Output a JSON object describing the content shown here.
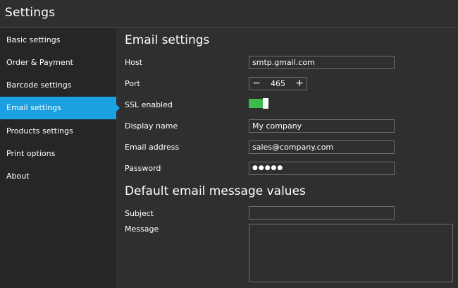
{
  "window": {
    "title": "Settings"
  },
  "sidebar": {
    "items": [
      {
        "label": "Basic settings"
      },
      {
        "label": "Order & Payment"
      },
      {
        "label": "Barcode settings"
      },
      {
        "label": "Email settings",
        "active": true
      },
      {
        "label": "Products settings"
      },
      {
        "label": "Print options"
      },
      {
        "label": "About"
      }
    ]
  },
  "email": {
    "heading": "Email settings",
    "host_label": "Host",
    "host_value": "smtp.gmail.com",
    "port_label": "Port",
    "port_value": "465",
    "port_minus": "−",
    "port_plus": "+",
    "ssl_label": "SSL enabled",
    "ssl_enabled": true,
    "display_name_label": "Display name",
    "display_name_value": "My company",
    "address_label": "Email address",
    "address_value": "sales@company.com",
    "password_label": "Password",
    "password_value": "●●●●●"
  },
  "defaults": {
    "heading": "Default email message values",
    "subject_label": "Subject",
    "subject_value": "",
    "message_label": "Message",
    "message_value": ""
  },
  "colors": {
    "accent": "#1ba1e2",
    "toggle_on": "#3dbb4a",
    "background": "#2f2f2f",
    "sidebar": "#262626"
  }
}
